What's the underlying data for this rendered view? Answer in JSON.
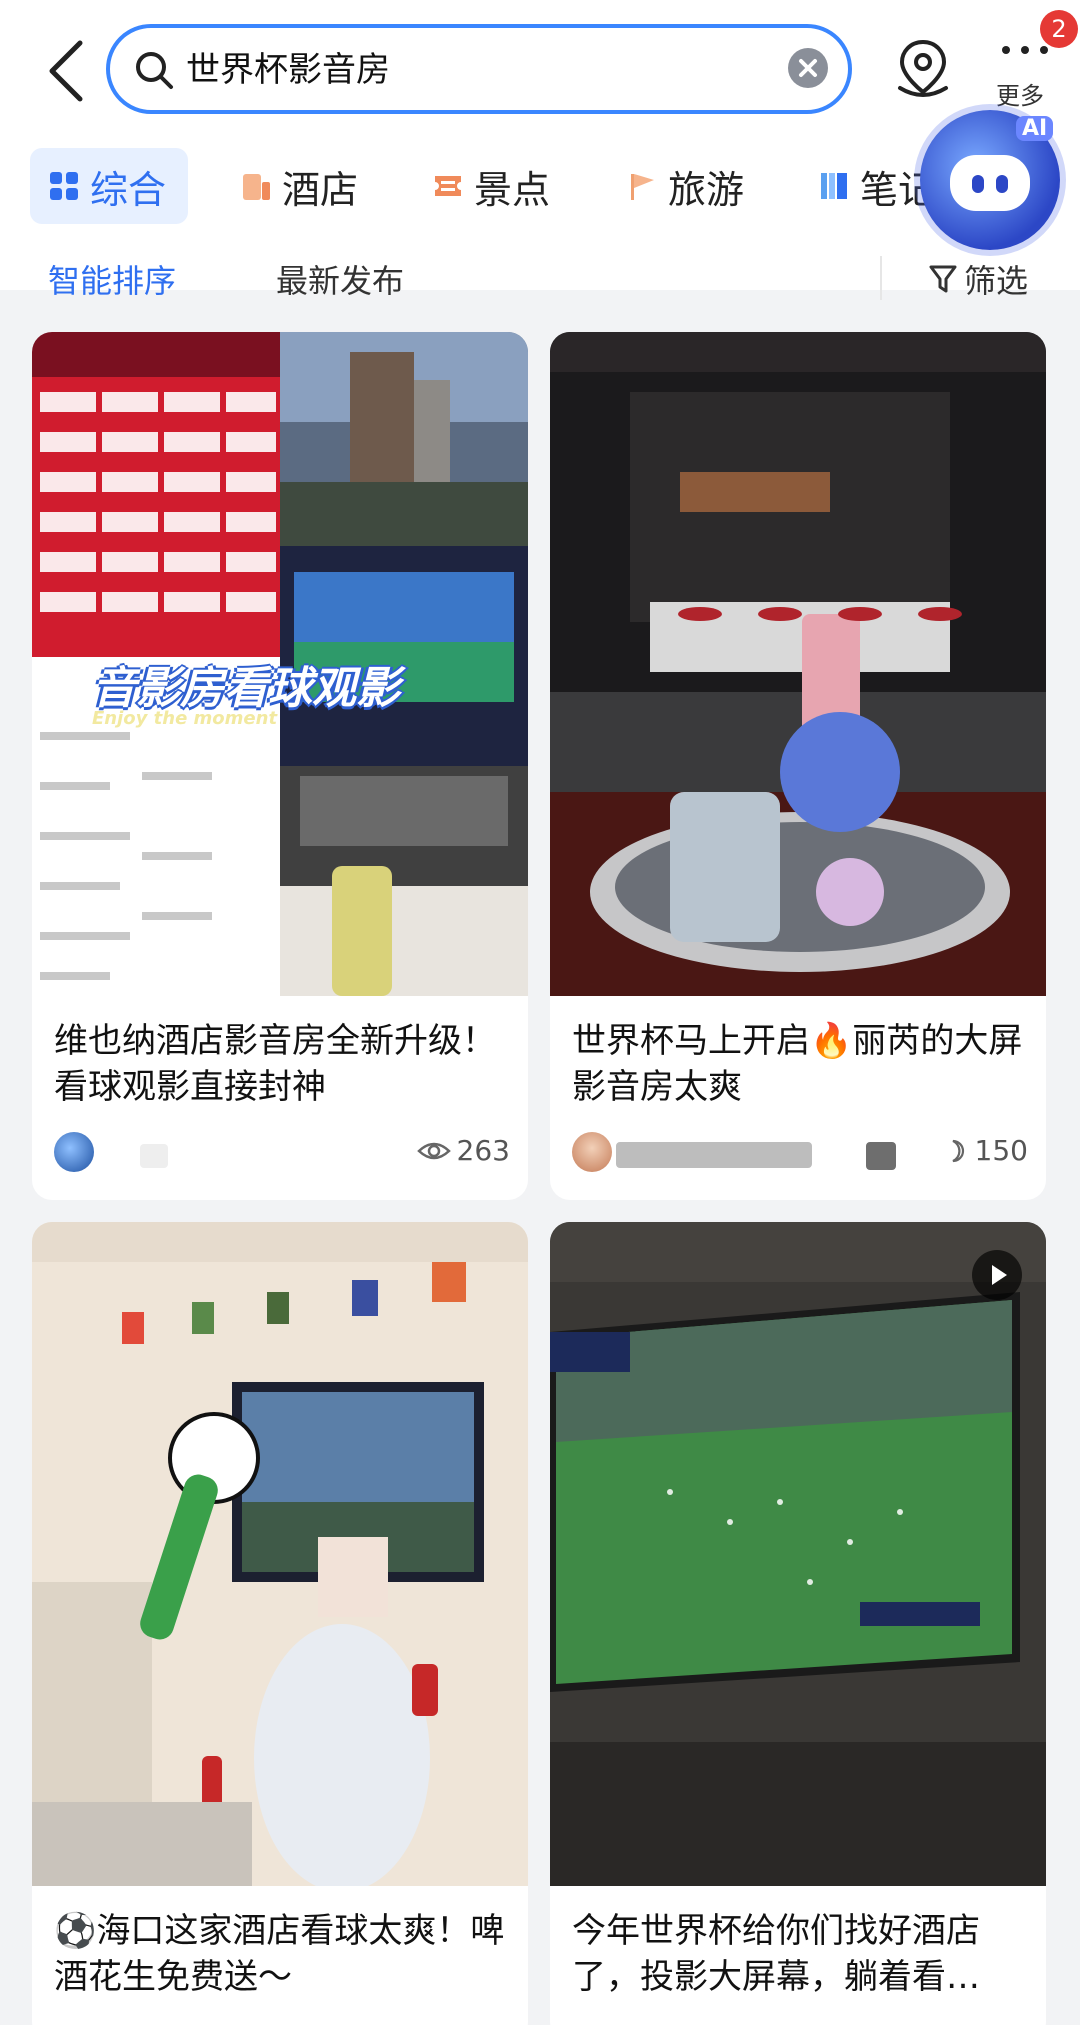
{
  "header": {
    "search_text": "世界杯影音房",
    "more_label": "更多",
    "badge_count": "2",
    "ai_label": "AI"
  },
  "tabs": [
    {
      "label": "综合",
      "icon": "grid-icon",
      "active": true
    },
    {
      "label": "酒店",
      "icon": "hotel-icon"
    },
    {
      "label": "景点",
      "icon": "ticket-icon"
    },
    {
      "label": "旅游",
      "icon": "flag-icon"
    },
    {
      "label": "笔记",
      "icon": "notebook-icon"
    }
  ],
  "sort": {
    "smart": "智能排序",
    "latest": "最新发布",
    "filter": "筛选"
  },
  "cards": [
    {
      "title": "维也纳酒店影音房全新升级！看球观影直接封神",
      "count": "263",
      "count_icon": "eye-icon",
      "overlay_title": "音影房看球观影",
      "overlay_sub": "Enjoy the moment"
    },
    {
      "title": "世界杯马上开启🔥丽芮的大屏影音房太爽",
      "count": "150",
      "count_icon": "moon-icon"
    },
    {
      "title": "⚽海口这家酒店看球太爽！啤酒花生免费送～"
    },
    {
      "title": "今年世界杯给你们找好酒店了，投影大屏幕，躺着看…"
    }
  ],
  "colors": {
    "accent": "#2f6ff0",
    "search_border": "#3a86ff",
    "badge": "#e53935"
  }
}
